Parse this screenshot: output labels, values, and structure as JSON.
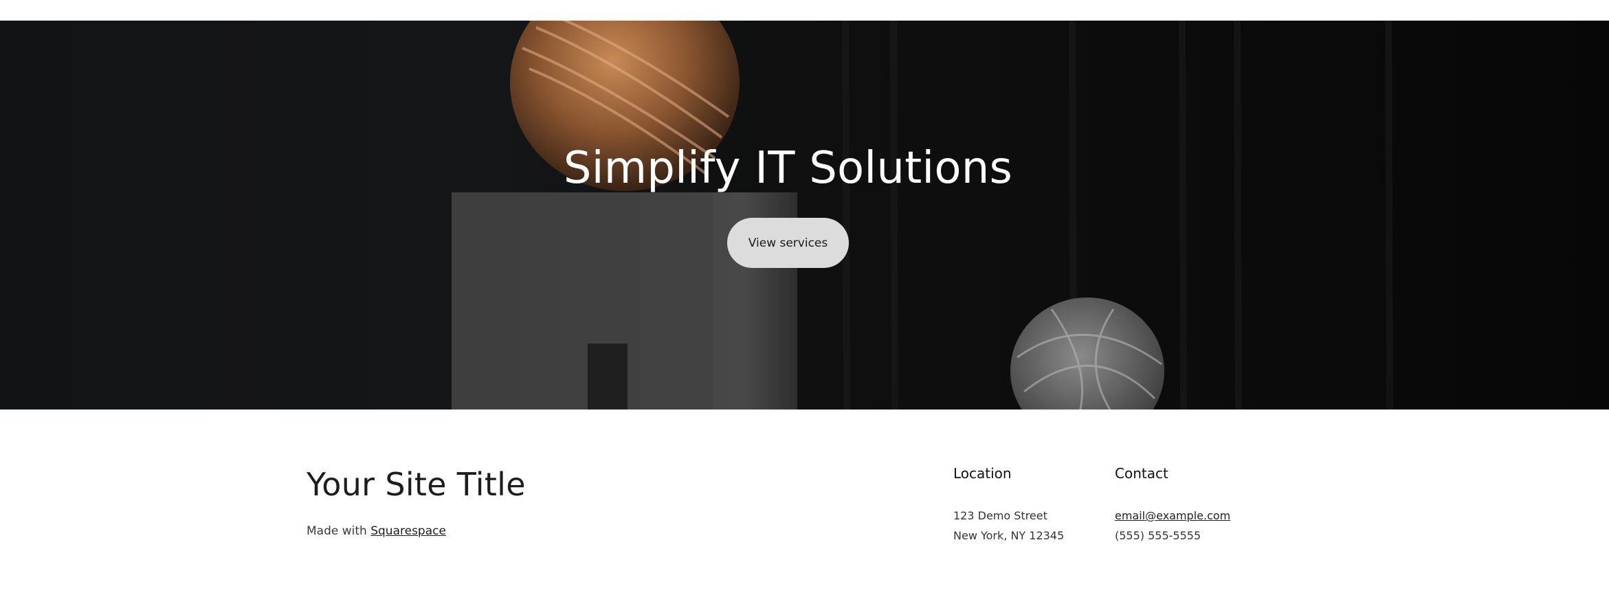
{
  "hero": {
    "title": "Simplify IT Solutions",
    "button_label": "View services"
  },
  "footer": {
    "site_title": "Your Site Title",
    "made_with_prefix": "Made with",
    "made_with_link": "Squarespace",
    "location": {
      "heading": "Location",
      "line1": "123 Demo Street",
      "line2": "New York, NY 12345"
    },
    "contact": {
      "heading": "Contact",
      "email": "email@example.com",
      "phone": "(555) 555-5555"
    }
  },
  "colors": {
    "hero_background": "#121315",
    "button_background": "#dcdcdc",
    "footer_background": "#ffffff",
    "text_dark": "#1d1d1d"
  }
}
